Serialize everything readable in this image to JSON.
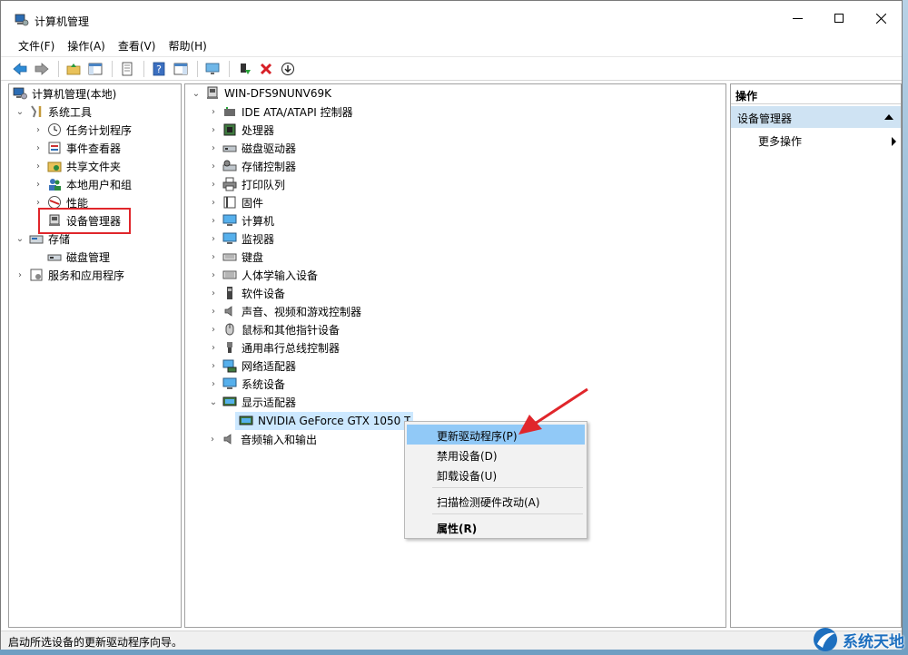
{
  "window": {
    "title": "计算机管理"
  },
  "menu": [
    "文件(F)",
    "操作(A)",
    "查看(V)",
    "帮助(H)"
  ],
  "left_tree": {
    "root": "计算机管理(本地)",
    "system_tools": "系统工具",
    "items": [
      "任务计划程序",
      "事件查看器",
      "共享文件夹",
      "本地用户和组",
      "性能",
      "设备管理器"
    ],
    "storage": "存储",
    "disk_mgmt": "磁盘管理",
    "services": "服务和应用程序"
  },
  "device_tree": {
    "computer": "WIN-DFS9NUNV69K",
    "categories": [
      "IDE ATA/ATAPI 控制器",
      "处理器",
      "磁盘驱动器",
      "存储控制器",
      "打印队列",
      "固件",
      "计算机",
      "监视器",
      "键盘",
      "人体学输入设备",
      "软件设备",
      "声音、视频和游戏控制器",
      "鼠标和其他指针设备",
      "通用串行总线控制器",
      "网络适配器",
      "系统设备",
      "显示适配器"
    ],
    "gpu": "NVIDIA GeForce GTX 1050 Ti",
    "audio": "音频输入和输出"
  },
  "context_menu": {
    "update": "更新驱动程序(P)",
    "disable": "禁用设备(D)",
    "uninstall": "卸载设备(U)",
    "scan": "扫描检测硬件改动(A)",
    "properties": "属性(R)"
  },
  "actions": {
    "header": "操作",
    "section": "设备管理器",
    "more": "更多操作"
  },
  "status": "启动所选设备的更新驱动程序向导。",
  "watermark": "系统天地",
  "colors": {
    "selection": "#cce8ff",
    "menu_highlight": "#91c9f7",
    "annotation": "#e0262b"
  }
}
